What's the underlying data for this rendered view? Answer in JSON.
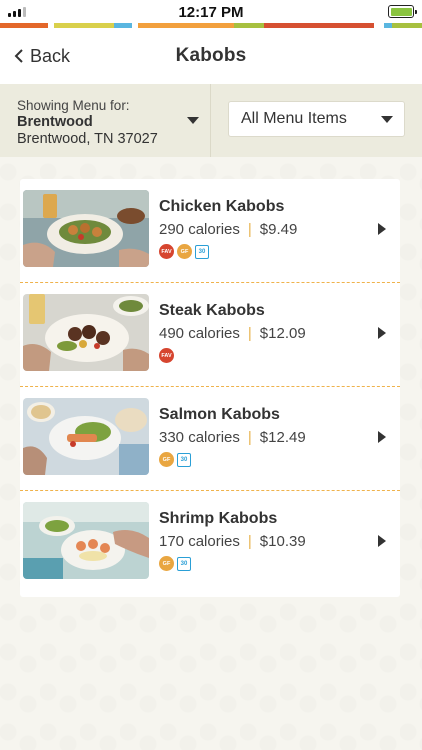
{
  "status_bar": {
    "time": "12:17 PM"
  },
  "nav": {
    "back_label": "Back",
    "title": "Kabobs"
  },
  "location": {
    "caption": "Showing Menu for:",
    "name": "Brentwood",
    "address": "Brentwood, TN 37027"
  },
  "filter": {
    "selected": "All Menu Items"
  },
  "brand_colors": [
    "#e3672a",
    "#d9d04b",
    "#5ab6e0",
    "#f2a03d",
    "#a7c03f",
    "#d65031"
  ],
  "items": [
    {
      "name": "Chicken Kabobs",
      "calories": "290 calories",
      "price": "$9.49",
      "badges": [
        "FAV",
        "GF",
        "30"
      ]
    },
    {
      "name": "Steak Kabobs",
      "calories": "490 calories",
      "price": "$12.09",
      "badges": [
        "FAV"
      ]
    },
    {
      "name": "Salmon Kabobs",
      "calories": "330 calories",
      "price": "$12.49",
      "badges": [
        "GF",
        "30"
      ]
    },
    {
      "name": "Shrimp Kabobs",
      "calories": "170 calories",
      "price": "$10.39",
      "badges": [
        "GF",
        "30"
      ]
    }
  ]
}
